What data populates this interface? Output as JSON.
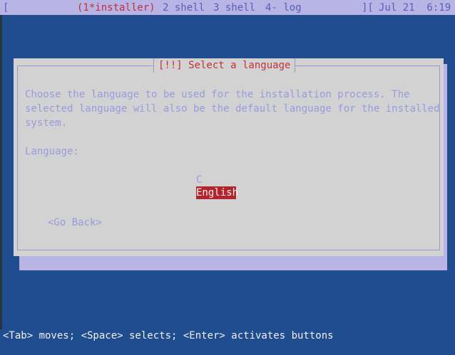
{
  "topbar": {
    "left_bracket": "[",
    "active_window": "(1*installer)",
    "window_2": "2 shell",
    "window_3": "3 shell",
    "window_4": "4- log",
    "right_bracket": "][",
    "clock": "Jul 21  6:19"
  },
  "dialog": {
    "title": "[!!] Select a language",
    "description_lines": [
      "Choose the language to be used for the installation process. The",
      "selected language will also be the default language for the installed",
      "system."
    ],
    "language_label": "Language:",
    "options": [
      "C",
      "English"
    ],
    "selected_option": "English",
    "go_back_label": "<Go Back>"
  },
  "help_bar": {
    "text": "<Tab> moves; <Space> selects; <Enter> activates buttons"
  },
  "colors": {
    "background": "#1f4d8f",
    "topbar": "#b8b4e6",
    "dialog": "#d2d2d2",
    "dialog_shadow": "#b8b4e6",
    "text_dim": "#9a9ae0",
    "title": "#c0303a",
    "selection": "#b3252d"
  }
}
